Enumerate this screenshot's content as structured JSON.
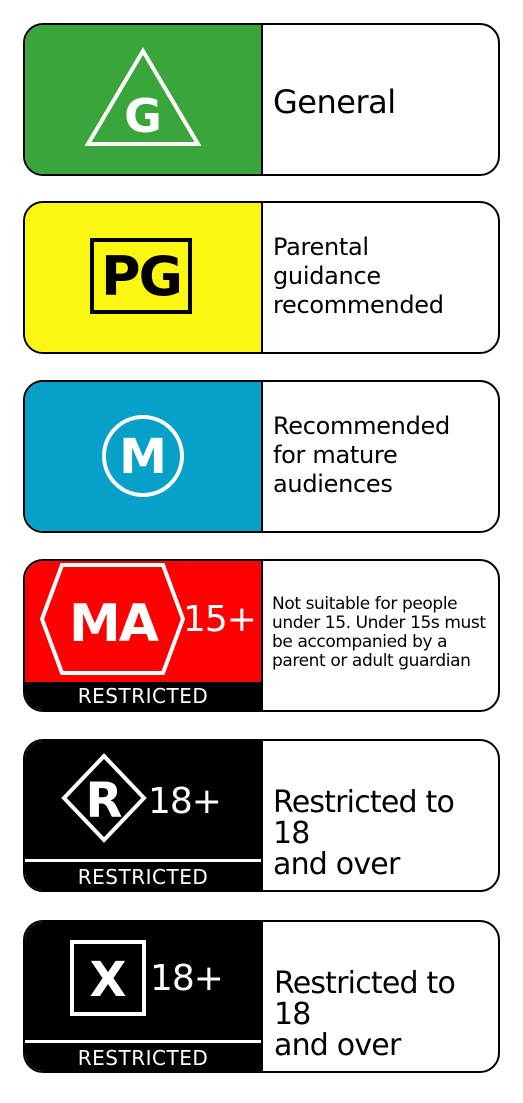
{
  "ratings": [
    {
      "code": "G",
      "badge_color": "#3aa53a",
      "description_lines": [
        "General"
      ]
    },
    {
      "code": "PG",
      "badge_color": "#fbf711",
      "description_lines": [
        "Parental",
        "guidance",
        "recommended"
      ]
    },
    {
      "code": "M",
      "badge_color": "#06a0c8",
      "description_lines": [
        "Recommended",
        "for mature",
        "audiences"
      ]
    },
    {
      "code": "MA",
      "age": "15+",
      "banner": "RESTRICTED",
      "badge_color": "#ff0000",
      "description_lines": [
        "Not suitable for people",
        "under 15. Under 15s must",
        "be accompanied by a",
        "parent or adult guardian"
      ]
    },
    {
      "code": "R",
      "age": "18+",
      "banner": "RESTRICTED",
      "badge_color": "#000000",
      "description_lines": [
        "Restricted to 18",
        "and over"
      ]
    },
    {
      "code": "X",
      "age": "18+",
      "banner": "RESTRICTED",
      "badge_color": "#000000",
      "description_lines": [
        "Restricted to 18",
        "and over"
      ]
    }
  ]
}
